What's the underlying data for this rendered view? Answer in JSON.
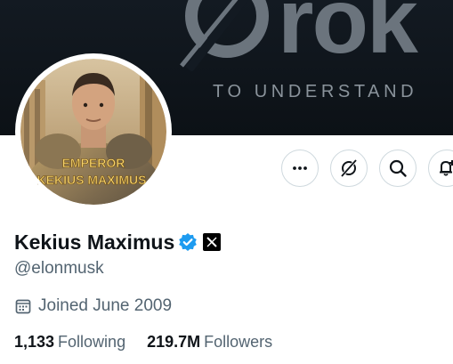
{
  "banner": {
    "logo_text": "rok",
    "tagline": "TO UNDERSTAND"
  },
  "avatar": {
    "caption_line1": "EMPEROR",
    "caption_line2": "KEKIUS MAXIMUS"
  },
  "actions": [
    {
      "icon": "more-icon",
      "label": "More"
    },
    {
      "icon": "grok-icon",
      "label": "Grok"
    },
    {
      "icon": "search-icon",
      "label": "Search"
    },
    {
      "icon": "bell-add-icon",
      "label": "Notifications"
    }
  ],
  "profile": {
    "display_name": "Kekius Maximus",
    "handle": "@elonmusk",
    "joined": "Joined June 2009"
  },
  "stats": {
    "following_count": "1,133",
    "following_label": "Following",
    "followers_count": "219.7M",
    "followers_label": "Followers"
  },
  "colors": {
    "verified": "#1d9bf0",
    "text_primary": "#0f1419",
    "text_secondary": "#536471",
    "banner_bg": "#0f1419"
  }
}
